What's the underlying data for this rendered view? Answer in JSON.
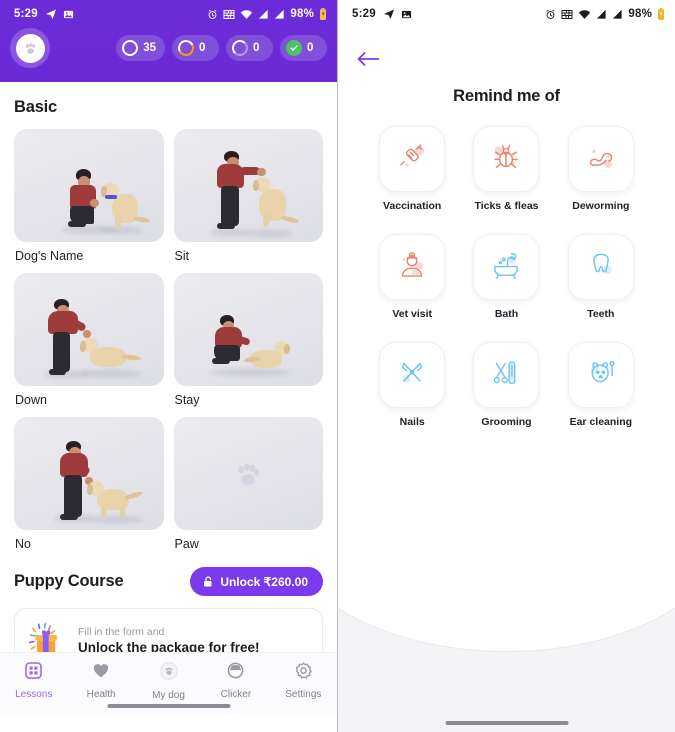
{
  "left_phone": {
    "status_bar": {
      "time": "5:29",
      "battery_percent": "98%",
      "icons": [
        "telegram-icon",
        "photos-icon",
        "alarm-icon",
        "vibrate-icon",
        "wifi-icon",
        "signal-1-icon",
        "signal-2-icon",
        "battery-icon"
      ]
    },
    "header": {
      "avatar_icon": "paw-avatar-icon",
      "badges": [
        {
          "icon": "ring-white-icon",
          "value": "35"
        },
        {
          "icon": "ring-orange-icon",
          "value": "0"
        },
        {
          "icon": "ring-lilac-icon",
          "value": "0"
        },
        {
          "icon": "check-green-icon",
          "value": "0"
        }
      ],
      "background_color": "#6c2bd9"
    },
    "basic_section": {
      "title": "Basic",
      "lessons": [
        {
          "label": "Dog's Name",
          "has_photo": true
        },
        {
          "label": "Sit",
          "has_photo": true
        },
        {
          "label": "Down",
          "has_photo": true
        },
        {
          "label": "Stay",
          "has_photo": true
        },
        {
          "label": "No",
          "has_photo": true
        },
        {
          "label": "Paw",
          "has_photo": false
        }
      ]
    },
    "puppy_course": {
      "title": "Puppy Course",
      "unlock_button": {
        "label": "Unlock ₹260.00",
        "icon": "unlock-icon",
        "color": "#7c3aed"
      },
      "promo": {
        "icon": "gift-icon",
        "subtitle": "Fill in the form and",
        "title": "Unlock the package for free!"
      }
    },
    "bottom_nav": {
      "active": "Lessons",
      "active_color": "#9a6ae8",
      "items": [
        {
          "label": "Lessons",
          "icon": "grid-icon"
        },
        {
          "label": "Health",
          "icon": "heart-icon"
        },
        {
          "label": "My dog",
          "icon": "dog-circle-icon"
        },
        {
          "label": "Clicker",
          "icon": "clicker-icon"
        },
        {
          "label": "Settings",
          "icon": "gear-icon"
        }
      ]
    }
  },
  "right_phone": {
    "status_bar": {
      "time": "5:29",
      "battery_percent": "98%"
    },
    "back_button": {
      "icon": "arrow-left-icon",
      "color": "#7c3aed"
    },
    "title": "Remind me of",
    "reminders": [
      {
        "label": "Vaccination",
        "icon": "syringe-icon",
        "color": "#e8836f"
      },
      {
        "label": "Ticks & fleas",
        "icon": "tick-icon",
        "color": "#e8836f"
      },
      {
        "label": "Deworming",
        "icon": "worm-icon",
        "color": "#e8836f"
      },
      {
        "label": "Vet visit",
        "icon": "vet-icon",
        "color": "#e8836f"
      },
      {
        "label": "Bath",
        "icon": "bathtub-icon",
        "color": "#6cc5ef"
      },
      {
        "label": "Teeth",
        "icon": "tooth-icon",
        "color": "#6cc5ef"
      },
      {
        "label": "Nails",
        "icon": "clipper-icon",
        "color": "#6cc5ef"
      },
      {
        "label": "Grooming",
        "icon": "scissors-comb-icon",
        "color": "#6cc5ef"
      },
      {
        "label": "Ear cleaning",
        "icon": "dog-ear-icon",
        "color": "#6cc5ef"
      }
    ]
  }
}
